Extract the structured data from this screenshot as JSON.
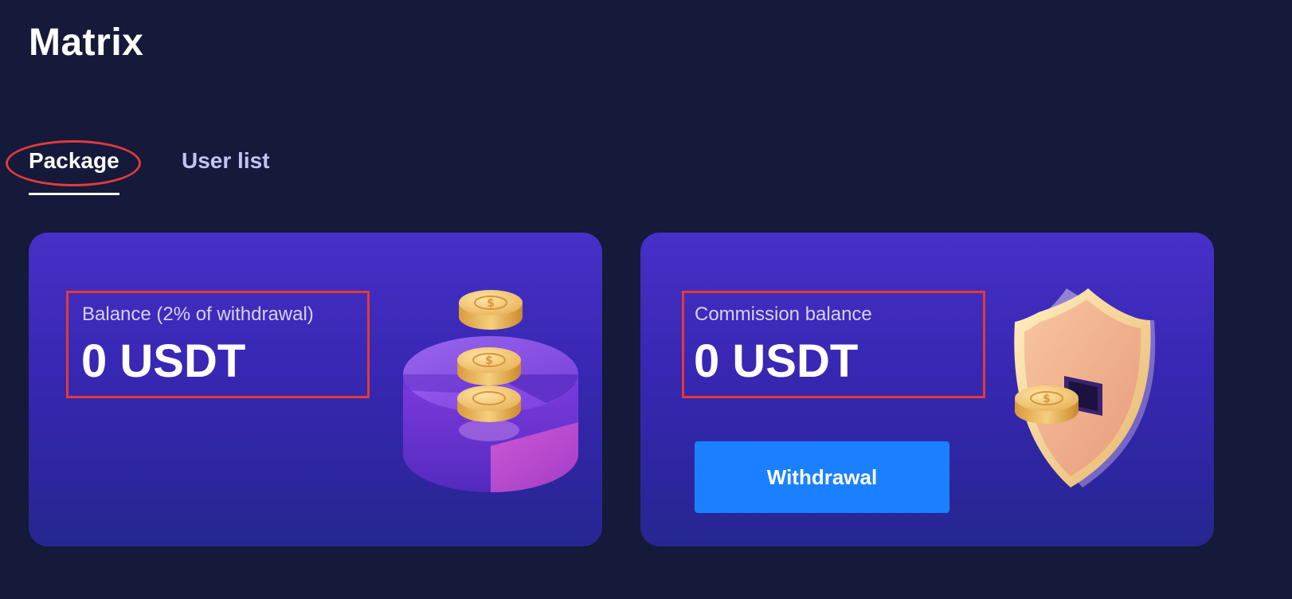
{
  "header": {
    "title": "Matrix"
  },
  "tabs": [
    {
      "label": "Package",
      "active": true
    },
    {
      "label": "User list",
      "active": false
    }
  ],
  "cards": [
    {
      "label": "Balance (2% of withdrawal)",
      "value": "0 USDT",
      "illustration": "coins-chart-icon"
    },
    {
      "label": "Commission balance",
      "value": "0 USDT",
      "button_label": "Withdrawal",
      "illustration": "shield-coin-icon"
    }
  ],
  "colors": {
    "background": "#15193a",
    "card_gradient_top": "#4630c7",
    "card_gradient_bottom": "#262690",
    "button": "#1a80ff",
    "annotation": "#e53935"
  }
}
